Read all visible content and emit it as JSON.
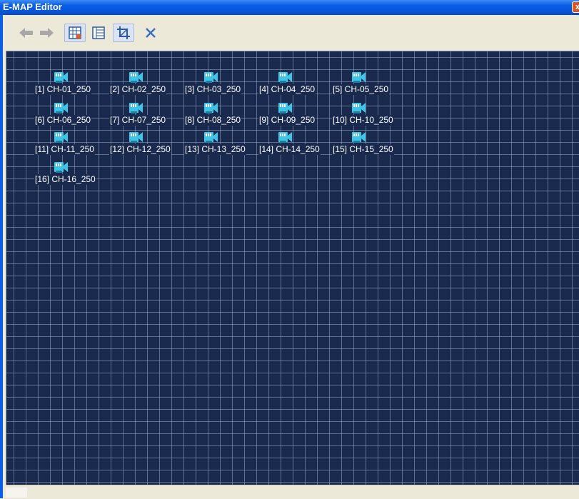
{
  "window": {
    "title": "E-MAP Editor",
    "close_glyph": "x"
  },
  "toolbar": {
    "buttons": [
      {
        "icon": "back-arrow-icon"
      },
      {
        "icon": "forward-arrow-icon"
      },
      {
        "icon": "add-map-icon"
      },
      {
        "icon": "map-list-icon"
      },
      {
        "icon": "crop-icon"
      },
      {
        "icon": "delete-x-icon"
      }
    ]
  },
  "map": {
    "cameras": [
      {
        "label": "[1] CH-01_250"
      },
      {
        "label": "[2] CH-02_250"
      },
      {
        "label": "[3] CH-03_250"
      },
      {
        "label": "[4] CH-04_250"
      },
      {
        "label": "[5] CH-05_250"
      },
      {
        "label": "[6] CH-06_250"
      },
      {
        "label": "[7] CH-07_250"
      },
      {
        "label": "[8] CH-08_250"
      },
      {
        "label": "[9] CH-09_250"
      },
      {
        "label": "[10] CH-10_250"
      },
      {
        "label": "[11] CH-11_250"
      },
      {
        "label": "[12] CH-12_250"
      },
      {
        "label": "[13] CH-13_250"
      },
      {
        "label": "[14] CH-14_250"
      },
      {
        "label": "[15] CH-15_250"
      },
      {
        "label": "[16] CH-16_250"
      }
    ]
  },
  "colors": {
    "canvas_bg": "#1a2a4f",
    "grid_line": "#8a97b5",
    "camera_icon": "#3ec4e6",
    "title_bar": "#0a5fe6"
  }
}
